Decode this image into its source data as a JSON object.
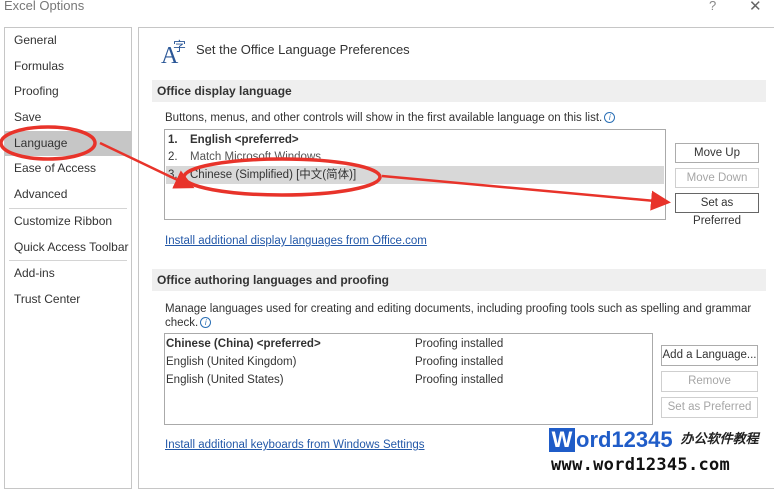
{
  "window": {
    "title": "Excel Options",
    "help_glyph": "?",
    "close_glyph": "✕"
  },
  "sidebar": {
    "items": [
      {
        "label": "General"
      },
      {
        "label": "Formulas"
      },
      {
        "label": "Proofing"
      },
      {
        "label": "Save"
      },
      {
        "label": "Language"
      },
      {
        "label": "Ease of Access"
      },
      {
        "label": "Advanced"
      },
      {
        "label": "Customize Ribbon"
      },
      {
        "label": "Quick Access Toolbar"
      },
      {
        "label": "Add-ins"
      },
      {
        "label": "Trust Center"
      }
    ],
    "selected": "Language"
  },
  "main": {
    "header_title": "Set the Office Language Preferences",
    "display": {
      "section_title": "Office display language",
      "description": "Buttons, menus, and other controls will show in the first available language on this list.",
      "languages": [
        {
          "num": "1.",
          "label": "English <preferred>"
        },
        {
          "num": "2.",
          "label": "Match Microsoft Windows"
        },
        {
          "num": "3.",
          "label": "Chinese (Simplified) [中文(简体)]"
        }
      ],
      "selected_index": 2,
      "move_up": "Move Up",
      "move_down": "Move Down",
      "set_preferred": "Set as Preferred",
      "install_link": "Install additional display languages from Office.com"
    },
    "authoring": {
      "section_title": "Office authoring languages and proofing",
      "description": "Manage languages used for creating and editing documents, including proofing tools such as spelling and grammar check.",
      "rows": [
        {
          "language": "Chinese (China) <preferred>",
          "status": "Proofing installed"
        },
        {
          "language": "English (United Kingdom)",
          "status": "Proofing installed"
        },
        {
          "language": "English (United States)",
          "status": "Proofing installed"
        }
      ],
      "add_language": "Add a Language...",
      "remove": "Remove",
      "set_preferred": "Set as Preferred",
      "keyboards_link": "Install additional keyboards from Windows Settings"
    }
  },
  "watermark": {
    "brand_first": "W",
    "brand_rest": "ord12345",
    "tagline": "办公软件教程",
    "url": "www.word12345.com"
  },
  "colors": {
    "annotation_red": "#e8332a",
    "link_blue": "#2358a8",
    "brand_blue": "#1f5cc8"
  }
}
